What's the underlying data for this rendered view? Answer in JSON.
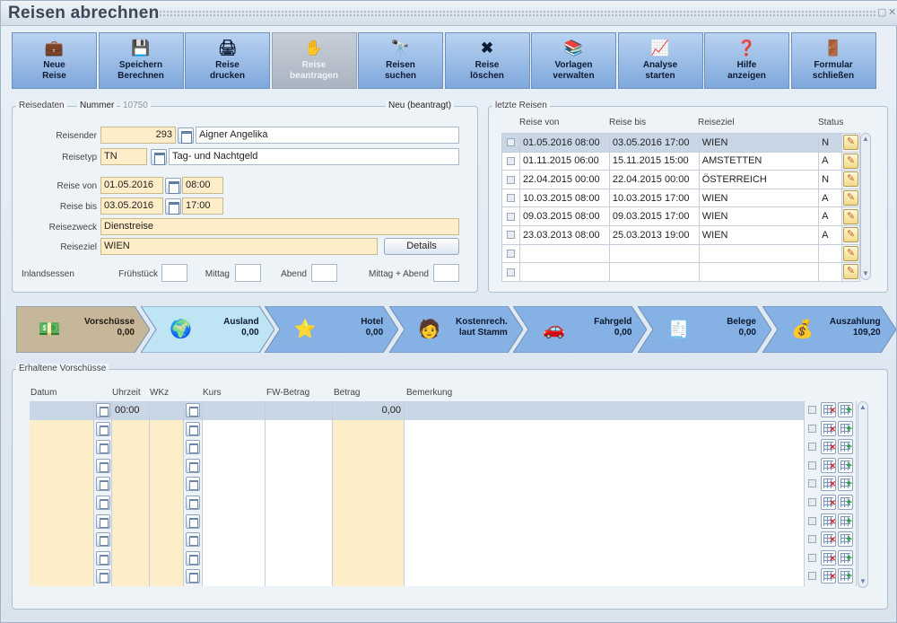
{
  "window": {
    "title": "Reisen abrechnen",
    "minimize": "▢",
    "close": "✕"
  },
  "toolbar": [
    {
      "label": "Neue\nReise",
      "icon": "new-trip-icon",
      "glyph": "💼",
      "enabled": true
    },
    {
      "label": "Speichern\nBerechnen",
      "icon": "save-icon",
      "glyph": "💾",
      "enabled": true
    },
    {
      "label": "Reise\ndrucken",
      "icon": "printer-icon",
      "glyph": "🖨",
      "enabled": true
    },
    {
      "label": "Reise\nbeantragen",
      "icon": "request-icon",
      "glyph": "✋",
      "enabled": false
    },
    {
      "label": "Reisen\nsuchen",
      "icon": "binoculars-icon",
      "glyph": "🔭",
      "enabled": true
    },
    {
      "label": "Reise\nlöschen",
      "icon": "delete-trip-icon",
      "glyph": "✖",
      "enabled": true
    },
    {
      "label": "Vorlagen\nverwalten",
      "icon": "templates-icon",
      "glyph": "📚",
      "enabled": true
    },
    {
      "label": "Analyse\nstarten",
      "icon": "analysis-icon",
      "glyph": "📈",
      "enabled": true
    },
    {
      "label": "Hilfe\nanzeigen",
      "icon": "help-icon",
      "glyph": "❓",
      "enabled": true
    },
    {
      "label": "Formular\nschließen",
      "icon": "exit-door-icon",
      "glyph": "🚪",
      "enabled": true
    }
  ],
  "reisedaten": {
    "legend": "Reisedaten",
    "nummer_label": "Nummer",
    "nummer": "10750",
    "status": "Neu (beantragt)",
    "reisender_label": "Reisender",
    "reisender_nr": "293",
    "reisender_name": "Aigner Angelika",
    "reisetyp_label": "Reisetyp",
    "reisetyp_code": "TN",
    "reisetyp_name": "Tag- und Nachtgeld",
    "von_label": "Reise von",
    "von_datum": "01.05.2016",
    "von_zeit": "08:00",
    "bis_label": "Reise bis",
    "bis_datum": "03.05.2016",
    "bis_zeit": "17:00",
    "zweck_label": "Reisezweck",
    "zweck": "Dienstreise",
    "ziel_label": "Reiseziel",
    "ziel": "WIEN",
    "details": "Details",
    "inland_label": "Inlandsessen",
    "fruehstueck": "Frühstück",
    "mittag": "Mittag",
    "abend": "Abend",
    "mittag_abend": "Mittag + Abend"
  },
  "letzte": {
    "legend": "letzte Reisen",
    "headers": [
      "Reise von",
      "Reise bis",
      "Reiseziel",
      "Status"
    ],
    "rows": [
      [
        "01.05.2016 08:00",
        "03.05.2016 17:00",
        "WIEN",
        "N"
      ],
      [
        "01.11.2015 06:00",
        "15.11.2015 15:00",
        "AMSTETTEN",
        "A"
      ],
      [
        "22.04.2015 00:00",
        "22.04.2015 00:00",
        "ÖSTERREICH",
        "N"
      ],
      [
        "10.03.2015 08:00",
        "10.03.2015 17:00",
        "WIEN",
        "A"
      ],
      [
        "09.03.2015 08:00",
        "09.03.2015 17:00",
        "WIEN",
        "A"
      ],
      [
        "23.03.2013 08:00",
        "25.03.2013 19:00",
        "WIEN",
        "A"
      ],
      [
        "",
        "",
        "",
        ""
      ],
      [
        "",
        "",
        "",
        ""
      ]
    ]
  },
  "steps": [
    {
      "name": "Vorschüsse",
      "value": "0,00",
      "icon": "money-envelope-icon",
      "glyph": "💵",
      "color": "#c7b79a",
      "text": "#1e1a10"
    },
    {
      "name": "Ausland",
      "value": "0,00",
      "icon": "globe-icon",
      "glyph": "🌍",
      "color": "#bfe5f5",
      "text": "#0c1a30"
    },
    {
      "name": "Hotel",
      "value": "0,00",
      "icon": "hotel-stars-icon",
      "glyph": "⭐",
      "color": "#86b1e4",
      "text": "#0c1a30"
    },
    {
      "name": "Kostenrech.\nlaut Stamm",
      "value": "",
      "icon": "person-icon",
      "glyph": "🧑",
      "color": "#86b1e4",
      "text": "#0c1a30"
    },
    {
      "name": "Fahrgeld",
      "value": "0,00",
      "icon": "car-icon",
      "glyph": "🚗",
      "color": "#86b1e4",
      "text": "#0c1a30"
    },
    {
      "name": "Belege",
      "value": "0,00",
      "icon": "receipt-icon",
      "glyph": "🧾",
      "color": "#86b1e4",
      "text": "#0c1a30"
    },
    {
      "name": "Auszahlung",
      "value": "109,20",
      "icon": "cash-register-icon",
      "glyph": "💰",
      "color": "#86b1e4",
      "text": "#0c1a30"
    }
  ],
  "vorschuesse": {
    "legend": "Erhaltene Vorschüsse",
    "headers": [
      "Datum",
      "Uhrzeit",
      "WKz",
      "Kurs",
      "FW-Betrag",
      "Betrag",
      "Bemerkung"
    ],
    "first_row": {
      "uhrzeit": "00:00",
      "betrag": "0,00"
    },
    "row_count": 10
  }
}
